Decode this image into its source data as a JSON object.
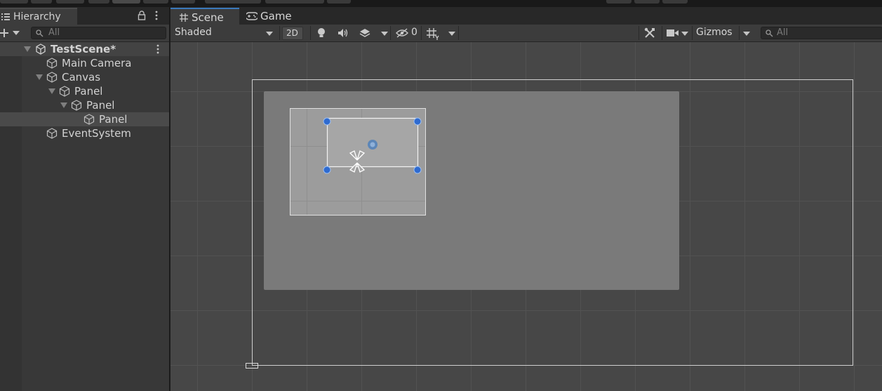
{
  "hierarchy": {
    "tab_label": "Hierarchy",
    "search_placeholder": "All",
    "scene_name": "TestScene*",
    "items": [
      {
        "label": "Main Camera"
      },
      {
        "label": "Canvas"
      },
      {
        "label": "Panel"
      },
      {
        "label": "Panel"
      },
      {
        "label": "Panel"
      },
      {
        "label": "EventSystem"
      }
    ]
  },
  "scene_view": {
    "tabs": [
      {
        "label": "Scene",
        "icon": "grid-icon",
        "active": true
      },
      {
        "label": "Game",
        "icon": "gamepad-icon",
        "active": false
      }
    ],
    "toolbar": {
      "draw_mode": "Shaded",
      "mode_2d_label": "2D",
      "hidden_count": "0",
      "gizmos_label": "Gizmos",
      "search_placeholder": "All"
    }
  },
  "colors": {
    "accent": "#3a79bb",
    "panel_bg": "#383838",
    "scene_bg": "#474747",
    "canvas_fill": "#7a7a7a",
    "selection_handle": "#3b7dd8"
  }
}
